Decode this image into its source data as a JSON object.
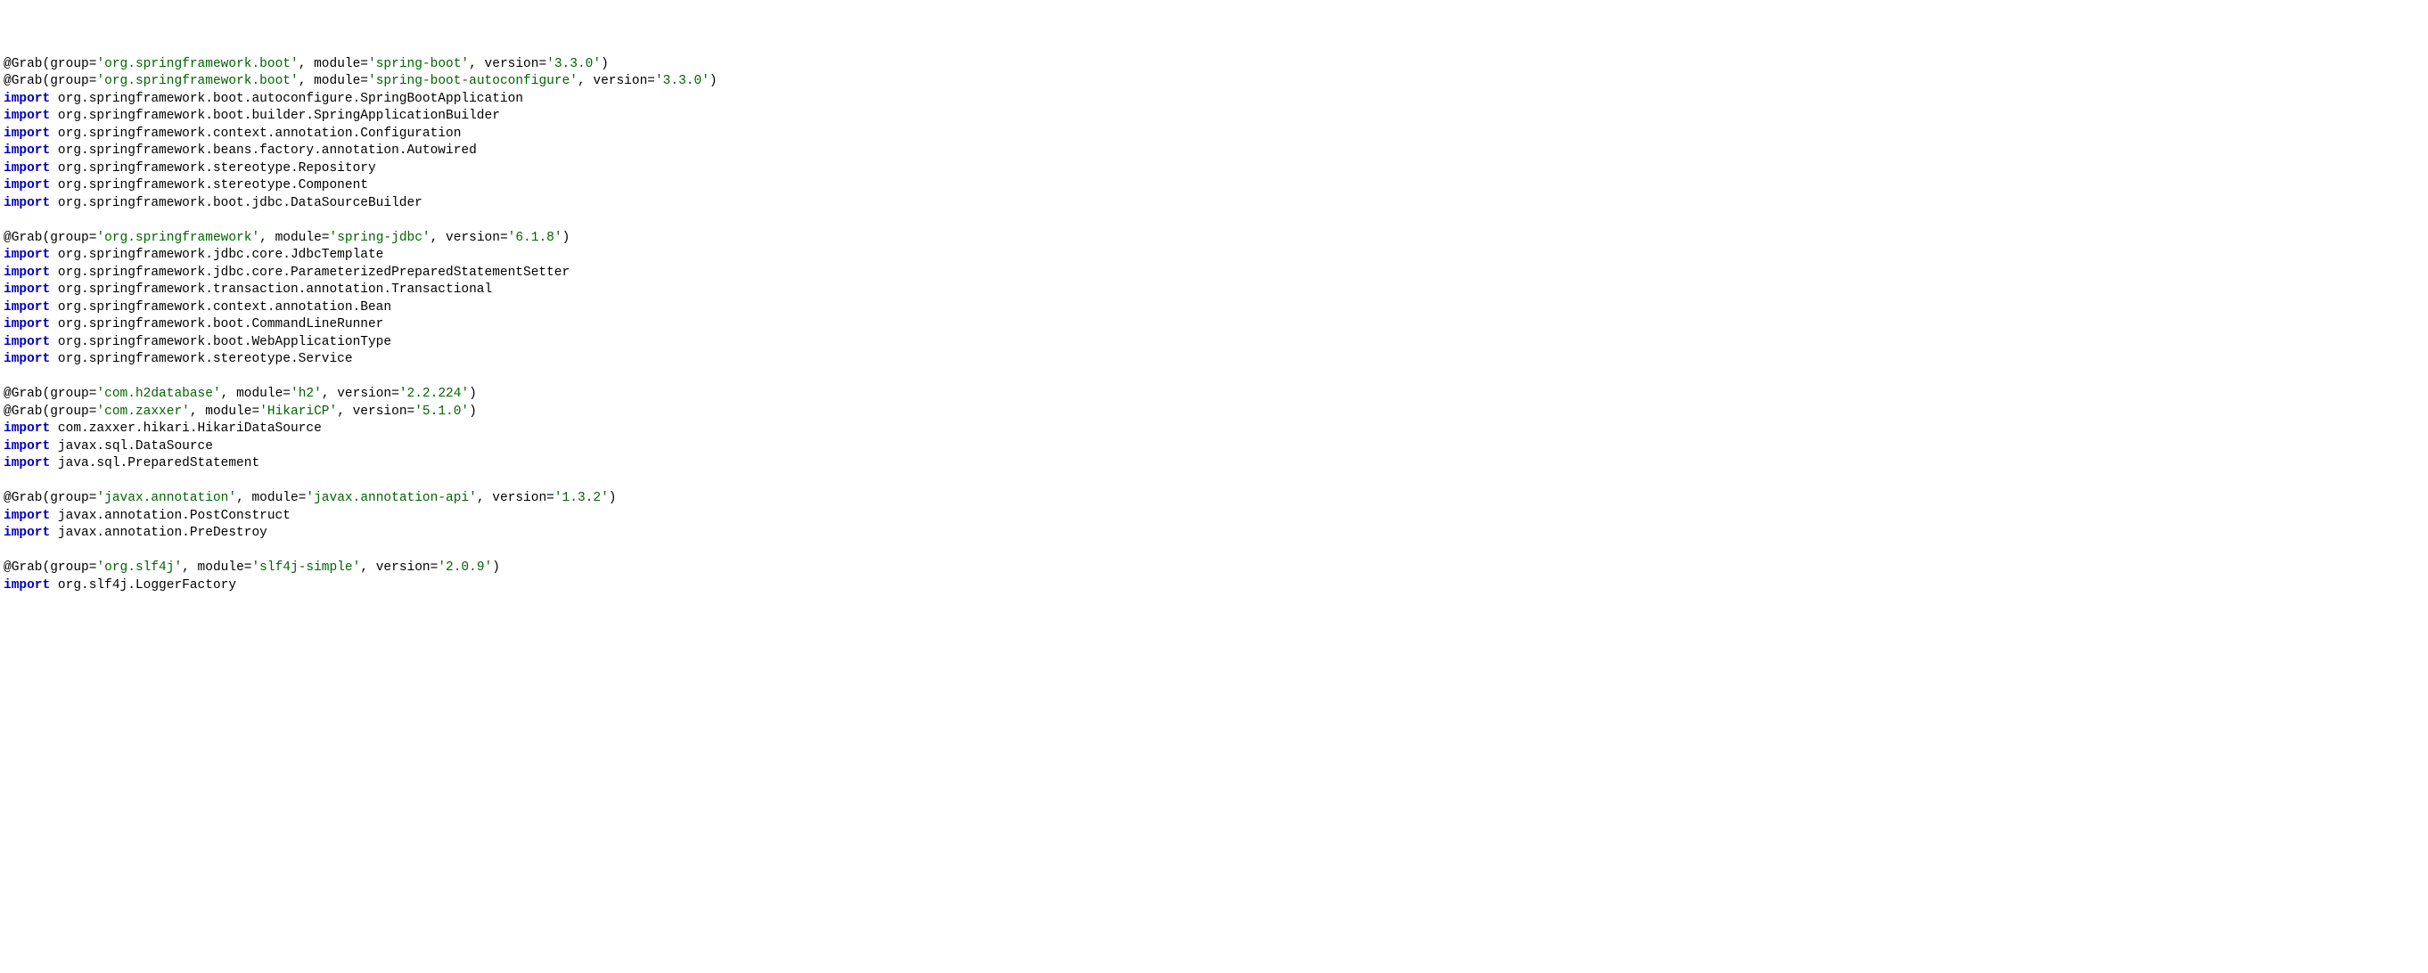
{
  "lines": [
    [
      {
        "cls": "at",
        "t": "@Grab"
      },
      {
        "cls": "plain",
        "t": "(group="
      },
      {
        "cls": "str",
        "t": "'org.springframework.boot'"
      },
      {
        "cls": "plain",
        "t": ", module="
      },
      {
        "cls": "str",
        "t": "'spring-boot'"
      },
      {
        "cls": "plain",
        "t": ", version="
      },
      {
        "cls": "str",
        "t": "'3.3.0'"
      },
      {
        "cls": "plain",
        "t": ")"
      }
    ],
    [
      {
        "cls": "at",
        "t": "@Grab"
      },
      {
        "cls": "plain",
        "t": "(group="
      },
      {
        "cls": "str",
        "t": "'org.springframework.boot'"
      },
      {
        "cls": "plain",
        "t": ", module="
      },
      {
        "cls": "str",
        "t": "'spring-boot-autoconfigure'"
      },
      {
        "cls": "plain",
        "t": ", version="
      },
      {
        "cls": "str",
        "t": "'3.3.0'"
      },
      {
        "cls": "plain",
        "t": ")"
      }
    ],
    [
      {
        "cls": "kw",
        "t": "import"
      },
      {
        "cls": "plain",
        "t": " org.springframework.boot.autoconfigure.SpringBootApplication"
      }
    ],
    [
      {
        "cls": "kw",
        "t": "import"
      },
      {
        "cls": "plain",
        "t": " org.springframework.boot.builder.SpringApplicationBuilder"
      }
    ],
    [
      {
        "cls": "kw",
        "t": "import"
      },
      {
        "cls": "plain",
        "t": " org.springframework.context.annotation.Configuration"
      }
    ],
    [
      {
        "cls": "kw",
        "t": "import"
      },
      {
        "cls": "plain",
        "t": " org.springframework.beans.factory.annotation.Autowired"
      }
    ],
    [
      {
        "cls": "kw",
        "t": "import"
      },
      {
        "cls": "plain",
        "t": " org.springframework.stereotype.Repository"
      }
    ],
    [
      {
        "cls": "kw",
        "t": "import"
      },
      {
        "cls": "plain",
        "t": " org.springframework.stereotype.Component"
      }
    ],
    [
      {
        "cls": "kw",
        "t": "import"
      },
      {
        "cls": "plain",
        "t": " org.springframework.boot.jdbc.DataSourceBuilder"
      }
    ],
    [
      {
        "cls": "plain",
        "t": ""
      }
    ],
    [
      {
        "cls": "at",
        "t": "@Grab"
      },
      {
        "cls": "plain",
        "t": "(group="
      },
      {
        "cls": "str",
        "t": "'org.springframework'"
      },
      {
        "cls": "plain",
        "t": ", module="
      },
      {
        "cls": "str",
        "t": "'spring-jdbc'"
      },
      {
        "cls": "plain",
        "t": ", version="
      },
      {
        "cls": "str",
        "t": "'6.1.8'"
      },
      {
        "cls": "plain",
        "t": ")"
      }
    ],
    [
      {
        "cls": "kw",
        "t": "import"
      },
      {
        "cls": "plain",
        "t": " org.springframework.jdbc.core.JdbcTemplate"
      }
    ],
    [
      {
        "cls": "kw",
        "t": "import"
      },
      {
        "cls": "plain",
        "t": " org.springframework.jdbc.core.ParameterizedPreparedStatementSetter"
      }
    ],
    [
      {
        "cls": "kw",
        "t": "import"
      },
      {
        "cls": "plain",
        "t": " org.springframework.transaction.annotation.Transactional"
      }
    ],
    [
      {
        "cls": "kw",
        "t": "import"
      },
      {
        "cls": "plain",
        "t": " org.springframework.context.annotation.Bean"
      }
    ],
    [
      {
        "cls": "kw",
        "t": "import"
      },
      {
        "cls": "plain",
        "t": " org.springframework.boot.CommandLineRunner"
      }
    ],
    [
      {
        "cls": "kw",
        "t": "import"
      },
      {
        "cls": "plain",
        "t": " org.springframework.boot.WebApplicationType"
      }
    ],
    [
      {
        "cls": "kw",
        "t": "import"
      },
      {
        "cls": "plain",
        "t": " org.springframework.stereotype.Service"
      }
    ],
    [
      {
        "cls": "plain",
        "t": ""
      }
    ],
    [
      {
        "cls": "at",
        "t": "@Grab"
      },
      {
        "cls": "plain",
        "t": "(group="
      },
      {
        "cls": "str",
        "t": "'com.h2database'"
      },
      {
        "cls": "plain",
        "t": ", module="
      },
      {
        "cls": "str",
        "t": "'h2'"
      },
      {
        "cls": "plain",
        "t": ", version="
      },
      {
        "cls": "str",
        "t": "'2.2.224'"
      },
      {
        "cls": "plain",
        "t": ")"
      }
    ],
    [
      {
        "cls": "at",
        "t": "@Grab"
      },
      {
        "cls": "plain",
        "t": "(group="
      },
      {
        "cls": "str",
        "t": "'com.zaxxer'"
      },
      {
        "cls": "plain",
        "t": ", module="
      },
      {
        "cls": "str",
        "t": "'HikariCP'"
      },
      {
        "cls": "plain",
        "t": ", version="
      },
      {
        "cls": "str",
        "t": "'5.1.0'"
      },
      {
        "cls": "plain",
        "t": ")"
      }
    ],
    [
      {
        "cls": "kw",
        "t": "import"
      },
      {
        "cls": "plain",
        "t": " com.zaxxer.hikari.HikariDataSource"
      }
    ],
    [
      {
        "cls": "kw",
        "t": "import"
      },
      {
        "cls": "plain",
        "t": " javax.sql.DataSource"
      }
    ],
    [
      {
        "cls": "kw",
        "t": "import"
      },
      {
        "cls": "plain",
        "t": " java.sql.PreparedStatement"
      }
    ],
    [
      {
        "cls": "plain",
        "t": ""
      }
    ],
    [
      {
        "cls": "at",
        "t": "@Grab"
      },
      {
        "cls": "plain",
        "t": "(group="
      },
      {
        "cls": "str",
        "t": "'javax.annotation'"
      },
      {
        "cls": "plain",
        "t": ", module="
      },
      {
        "cls": "str",
        "t": "'javax.annotation-api'"
      },
      {
        "cls": "plain",
        "t": ", version="
      },
      {
        "cls": "str",
        "t": "'1.3.2'"
      },
      {
        "cls": "plain",
        "t": ")"
      }
    ],
    [
      {
        "cls": "kw",
        "t": "import"
      },
      {
        "cls": "plain",
        "t": " javax.annotation.PostConstruct"
      }
    ],
    [
      {
        "cls": "kw",
        "t": "import"
      },
      {
        "cls": "plain",
        "t": " javax.annotation.PreDestroy"
      }
    ],
    [
      {
        "cls": "plain",
        "t": ""
      }
    ],
    [
      {
        "cls": "at",
        "t": "@Grab"
      },
      {
        "cls": "plain",
        "t": "(group="
      },
      {
        "cls": "str",
        "t": "'org.slf4j'"
      },
      {
        "cls": "plain",
        "t": ", module="
      },
      {
        "cls": "str",
        "t": "'slf4j-simple'"
      },
      {
        "cls": "plain",
        "t": ", version="
      },
      {
        "cls": "str",
        "t": "'2.0.9'"
      },
      {
        "cls": "plain",
        "t": ")"
      }
    ],
    [
      {
        "cls": "kw",
        "t": "import"
      },
      {
        "cls": "plain",
        "t": " org.slf4j.LoggerFactory"
      }
    ]
  ]
}
